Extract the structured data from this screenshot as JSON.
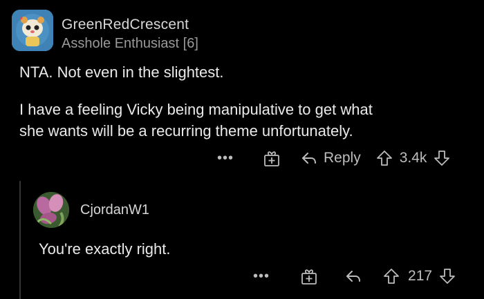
{
  "comment": {
    "username": "GreenRedCrescent",
    "flair": "Asshole Enthusiast [6]",
    "body_lines": [
      "NTA. Not even in the slightest.",
      "I have a feeling Vicky being manipulative to get what",
      "she wants will be a recurring theme unfortunately."
    ],
    "actions": {
      "more": "•••",
      "award_icon": "gift-icon",
      "reply_label": "Reply",
      "upvote_icon": "arrow-up-icon",
      "score": "3.4k",
      "downvote_icon": "arrow-down-icon"
    }
  },
  "reply": {
    "username": "CjordanW1",
    "body": "You're exactly right.",
    "actions": {
      "more": "•••",
      "award_icon": "gift-icon",
      "reply_icon": "reply-arrow-icon",
      "upvote_icon": "arrow-up-icon",
      "score": "217",
      "downvote_icon": "arrow-down-icon"
    }
  },
  "colors": {
    "background": "#000000",
    "text": "#eaeaea",
    "muted": "#9a9a9a",
    "icons": "#bdbdbd",
    "avatar_bg": "#3f83b6"
  }
}
